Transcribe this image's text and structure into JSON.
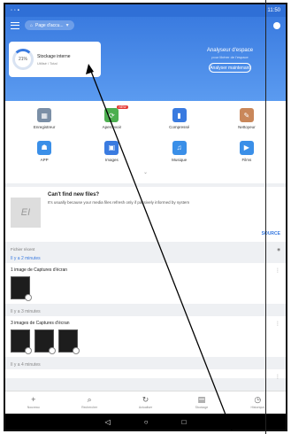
{
  "status": {
    "time": "11:50"
  },
  "header": {
    "breadcrumb": "Page d'accu...",
    "storage_title": "Stockage interne",
    "storage_subtitle": "Utilisé / Total",
    "storage_percent": "21%",
    "analyzer_title": "Analyseur d'espace",
    "analyzer_subtitle": "pour libérer de l'espace",
    "analyzer_button": "Analyser maintenant"
  },
  "categories": [
    {
      "label": "Enregistreur",
      "icon": "recorder-icon",
      "color": "#7b8fa6"
    },
    {
      "label": "Apercevoir",
      "icon": "apps-icon",
      "color": "#4caf50",
      "badge": "NEW"
    },
    {
      "label": "Compressé",
      "icon": "archive-icon",
      "color": "#3a7be0"
    },
    {
      "label": "Nettoyeur",
      "icon": "cleaner-icon",
      "color": "#c9875a"
    },
    {
      "label": "APP",
      "icon": "android-icon",
      "color": "#3a8fe8"
    },
    {
      "label": "Images",
      "icon": "image-icon",
      "color": "#3a7be0"
    },
    {
      "label": "Musique",
      "icon": "music-icon",
      "color": "#3a8fe8"
    },
    {
      "label": "Films",
      "icon": "video-icon",
      "color": "#3a8fe8"
    }
  ],
  "promo": {
    "logo": "EI",
    "title": "Can't find new files?",
    "desc": "It's usually because your media files refresh only if passively informed by system",
    "action": "SOURCE"
  },
  "recent": {
    "header": "Fichier récent",
    "groups": [
      {
        "time": "Il y a 2 minutes",
        "label": "1 image de Captures d'écran",
        "count": 1
      },
      {
        "time": "Il y a 3 minutes",
        "label": "3 images de Captures d'écran",
        "count": 3
      },
      {
        "time": "Il y a 4 minutes",
        "label": "",
        "count": 0
      }
    ]
  },
  "bottom_nav": [
    {
      "label": "Nouveau",
      "icon": "plus-icon"
    },
    {
      "label": "Rechercher",
      "icon": "search-icon"
    },
    {
      "label": "Actualiser",
      "icon": "refresh-icon"
    },
    {
      "label": "Stockage",
      "icon": "storage-icon"
    },
    {
      "label": "Historique",
      "icon": "history-icon"
    }
  ]
}
